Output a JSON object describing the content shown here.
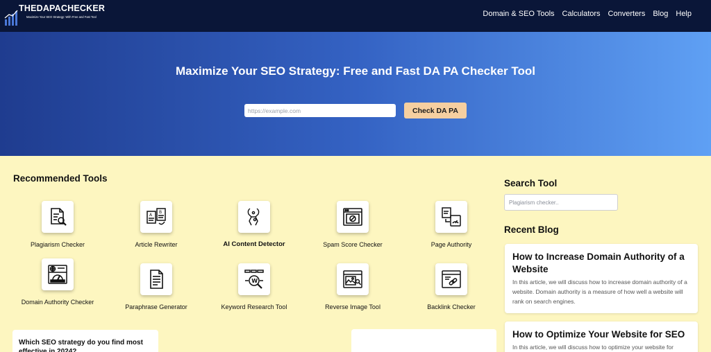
{
  "brand": {
    "title": "THEDAPACHECKER",
    "tagline": "Maximize Your SEO Strategy: With Free and Fast Tool"
  },
  "nav": {
    "links": [
      "Domain & SEO Tools",
      "Calculators",
      "Converters",
      "Blog",
      "Help"
    ]
  },
  "hero": {
    "title": "Maximize Your SEO Strategy: Free and Fast DA PA Checker Tool",
    "input_placeholder": "https://example.com",
    "button_label": "Check DA PA"
  },
  "tools": {
    "heading": "Recommended Tools",
    "items": [
      {
        "label": "Plagiarism Checker",
        "icon": "plagiarism-icon"
      },
      {
        "label": "Article Rewriter",
        "icon": "article-rewriter-icon"
      },
      {
        "label": "AI Content Detector",
        "icon": "ai-detector-icon"
      },
      {
        "label": "Spam Score Checker",
        "icon": "spam-score-icon"
      },
      {
        "label": "Page Authority",
        "icon": "page-authority-icon"
      },
      {
        "label": "Domain Authority Checker",
        "icon": "domain-authority-icon"
      },
      {
        "label": "Paraphrase Generator",
        "icon": "paraphrase-icon"
      },
      {
        "label": "Keyword Research Tool",
        "icon": "keyword-research-icon"
      },
      {
        "label": "Reverse Image Tool",
        "icon": "reverse-image-icon"
      },
      {
        "label": "Backlink Checker",
        "icon": "backlink-icon"
      }
    ]
  },
  "poll": {
    "question": "Which SEO strategy do you find most effective in 2024?"
  },
  "sidebar": {
    "search_heading": "Search Tool",
    "search_placeholder": "Plagiarism checker..",
    "blog_heading": "Recent Blog",
    "posts": [
      {
        "title": "How to Increase Domain Authority of a Website",
        "excerpt": "In this article, we will discuss how to increase domain authority of a website. Domain authority is a measure of how well a website will rank on search engines."
      },
      {
        "title": "How to Optimize Your Website for SEO",
        "excerpt": "In this article, we will discuss how to optimize your website for"
      }
    ]
  },
  "colors": {
    "nav_bg": "#0a1638",
    "hero_gradient_start": "#1f3c8f",
    "hero_gradient_end": "#5fa0f4",
    "page_bg": "#fdf6c0",
    "cta_button": "#f6cfa0"
  }
}
